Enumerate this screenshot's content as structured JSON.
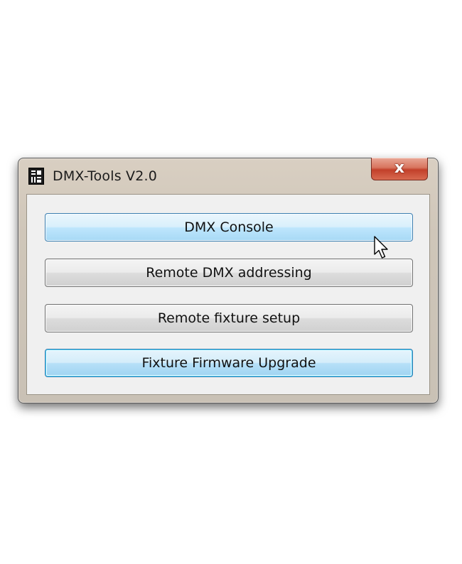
{
  "window": {
    "title": "DMX-Tools V2.0",
    "close_glyph": "x"
  },
  "buttons": [
    {
      "label": "DMX Console",
      "state": "hover"
    },
    {
      "label": "Remote DMX addressing",
      "state": "normal"
    },
    {
      "label": "Remote fixture setup",
      "state": "normal"
    },
    {
      "label": "Fixture Firmware Upgrade",
      "state": "focused"
    }
  ],
  "icons": {
    "app": "app-logo-icon",
    "close": "close-icon",
    "cursor": "mouse-pointer-icon"
  },
  "colors": {
    "close_red": "#c2402a",
    "hover_blue": "#bee6fd",
    "focus_border": "#3c7fb1"
  }
}
